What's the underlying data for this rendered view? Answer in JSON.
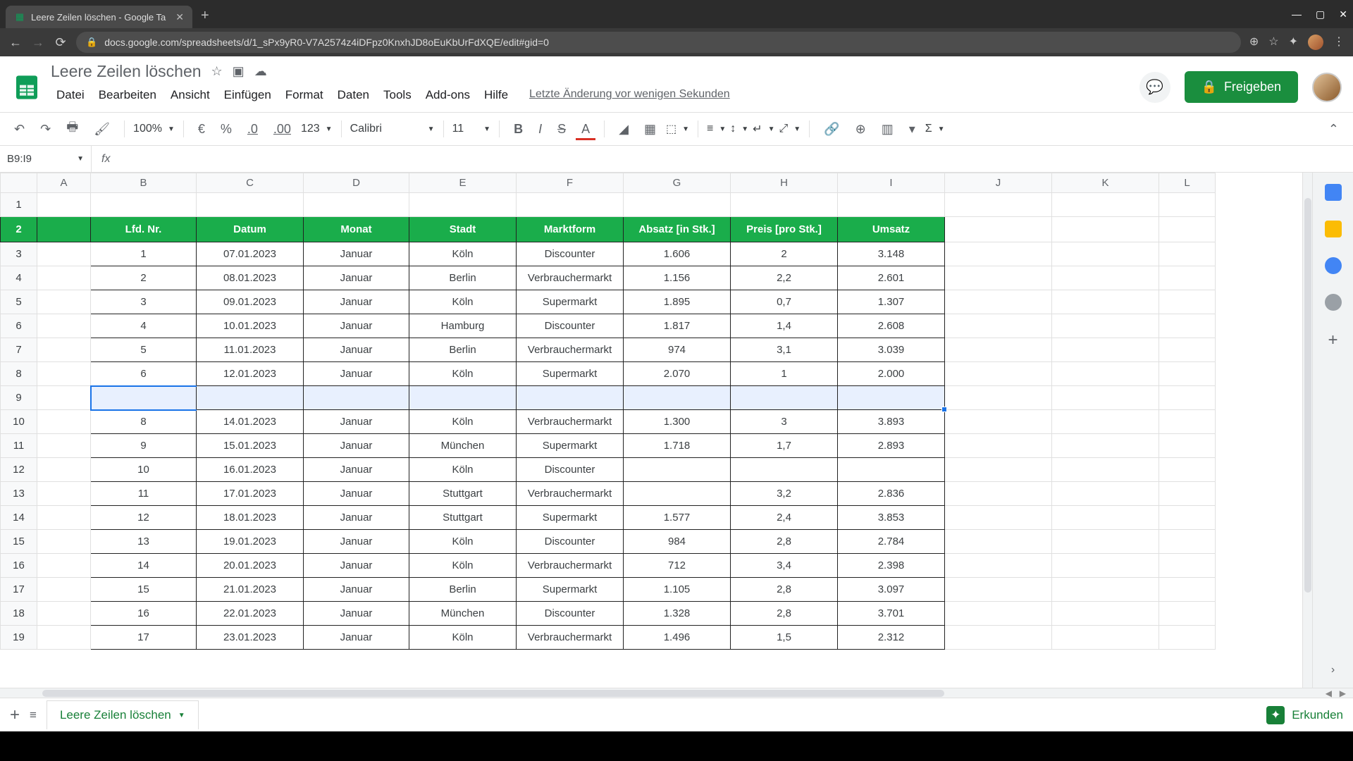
{
  "browser": {
    "tab_title": "Leere Zeilen löschen - Google Ta",
    "url": "docs.google.com/spreadsheets/d/1_sPx9yR0-V7A2574z4iDFpz0KnxhJD8oEuKbUrFdXQE/edit#gid=0"
  },
  "doc": {
    "title": "Leere Zeilen löschen",
    "menus": [
      "Datei",
      "Bearbeiten",
      "Ansicht",
      "Einfügen",
      "Format",
      "Daten",
      "Tools",
      "Add-ons",
      "Hilfe"
    ],
    "last_edit": "Letzte Änderung vor wenigen Sekunden",
    "share_label": "Freigeben"
  },
  "toolbar": {
    "zoom": "100%",
    "currency": "€",
    "percent": "%",
    "dec_less": ".0",
    "dec_more": ".00",
    "numfmt": "123",
    "font": "Calibri",
    "fontsize": "11"
  },
  "namebox": "B9:I9",
  "columns": [
    "A",
    "B",
    "C",
    "D",
    "E",
    "F",
    "G",
    "H",
    "I",
    "J",
    "K",
    "L"
  ],
  "colwidths": [
    "cA",
    "cB",
    "cC",
    "cD",
    "cE",
    "cF",
    "cG",
    "cH",
    "cI",
    "cJ",
    "cK",
    "cL"
  ],
  "row_numbers": [
    "1",
    "2",
    "3",
    "4",
    "5",
    "6",
    "7",
    "8",
    "9",
    "10",
    "11",
    "12",
    "13",
    "14",
    "15",
    "16",
    "17",
    "18",
    "19"
  ],
  "header_row": [
    "Lfd. Nr.",
    "Datum",
    "Monat",
    "Stadt",
    "Marktform",
    "Absatz [in Stk.]",
    "Preis [pro Stk.]",
    "Umsatz"
  ],
  "data_rows": [
    [
      "1",
      "07.01.2023",
      "Januar",
      "Köln",
      "Discounter",
      "1.606",
      "2",
      "3.148"
    ],
    [
      "2",
      "08.01.2023",
      "Januar",
      "Berlin",
      "Verbrauchermarkt",
      "1.156",
      "2,2",
      "2.601"
    ],
    [
      "3",
      "09.01.2023",
      "Januar",
      "Köln",
      "Supermarkt",
      "1.895",
      "0,7",
      "1.307"
    ],
    [
      "4",
      "10.01.2023",
      "Januar",
      "Hamburg",
      "Discounter",
      "1.817",
      "1,4",
      "2.608"
    ],
    [
      "5",
      "11.01.2023",
      "Januar",
      "Berlin",
      "Verbrauchermarkt",
      "974",
      "3,1",
      "3.039"
    ],
    [
      "6",
      "12.01.2023",
      "Januar",
      "Köln",
      "Supermarkt",
      "2.070",
      "1",
      "2.000"
    ],
    [
      "",
      "",
      "",
      "",
      "",
      "",
      "",
      ""
    ],
    [
      "8",
      "14.01.2023",
      "Januar",
      "Köln",
      "Verbrauchermarkt",
      "1.300",
      "3",
      "3.893"
    ],
    [
      "9",
      "15.01.2023",
      "Januar",
      "München",
      "Supermarkt",
      "1.718",
      "1,7",
      "2.893"
    ],
    [
      "10",
      "16.01.2023",
      "Januar",
      "Köln",
      "Discounter",
      "",
      "",
      ""
    ],
    [
      "11",
      "17.01.2023",
      "Januar",
      "Stuttgart",
      "Verbrauchermarkt",
      "",
      "3,2",
      "2.836"
    ],
    [
      "12",
      "18.01.2023",
      "Januar",
      "Stuttgart",
      "Supermarkt",
      "1.577",
      "2,4",
      "3.853"
    ],
    [
      "13",
      "19.01.2023",
      "Januar",
      "Köln",
      "Discounter",
      "984",
      "2,8",
      "2.784"
    ],
    [
      "14",
      "20.01.2023",
      "Januar",
      "Köln",
      "Verbrauchermarkt",
      "712",
      "3,4",
      "2.398"
    ],
    [
      "15",
      "21.01.2023",
      "Januar",
      "Berlin",
      "Supermarkt",
      "1.105",
      "2,8",
      "3.097"
    ],
    [
      "16",
      "22.01.2023",
      "Januar",
      "München",
      "Discounter",
      "1.328",
      "2,8",
      "3.701"
    ],
    [
      "17",
      "23.01.2023",
      "Januar",
      "Köln",
      "Verbrauchermarkt",
      "1.496",
      "1,5",
      "2.312"
    ]
  ],
  "selected_row_index": 6,
  "sheet_tab": "Leere Zeilen löschen",
  "explore": "Erkunden",
  "chart_data": {
    "type": "table",
    "columns": [
      "Lfd. Nr.",
      "Datum",
      "Monat",
      "Stadt",
      "Marktform",
      "Absatz [in Stk.]",
      "Preis [pro Stk.]",
      "Umsatz"
    ],
    "rows": [
      [
        1,
        "07.01.2023",
        "Januar",
        "Köln",
        "Discounter",
        1606,
        2,
        3148
      ],
      [
        2,
        "08.01.2023",
        "Januar",
        "Berlin",
        "Verbrauchermarkt",
        1156,
        2.2,
        2601
      ],
      [
        3,
        "09.01.2023",
        "Januar",
        "Köln",
        "Supermarkt",
        1895,
        0.7,
        1307
      ],
      [
        4,
        "10.01.2023",
        "Januar",
        "Hamburg",
        "Discounter",
        1817,
        1.4,
        2608
      ],
      [
        5,
        "11.01.2023",
        "Januar",
        "Berlin",
        "Verbrauchermarkt",
        974,
        3.1,
        3039
      ],
      [
        6,
        "12.01.2023",
        "Januar",
        "Köln",
        "Supermarkt",
        2070,
        1,
        2000
      ],
      [
        null,
        null,
        null,
        null,
        null,
        null,
        null,
        null
      ],
      [
        8,
        "14.01.2023",
        "Januar",
        "Köln",
        "Verbrauchermarkt",
        1300,
        3,
        3893
      ],
      [
        9,
        "15.01.2023",
        "Januar",
        "München",
        "Supermarkt",
        1718,
        1.7,
        2893
      ],
      [
        10,
        "16.01.2023",
        "Januar",
        "Köln",
        "Discounter",
        null,
        null,
        null
      ],
      [
        11,
        "17.01.2023",
        "Januar",
        "Stuttgart",
        "Verbrauchermarkt",
        null,
        3.2,
        2836
      ],
      [
        12,
        "18.01.2023",
        "Januar",
        "Stuttgart",
        "Supermarkt",
        1577,
        2.4,
        3853
      ],
      [
        13,
        "19.01.2023",
        "Januar",
        "Köln",
        "Discounter",
        984,
        2.8,
        2784
      ],
      [
        14,
        "20.01.2023",
        "Januar",
        "Köln",
        "Verbrauchermarkt",
        712,
        3.4,
        2398
      ],
      [
        15,
        "21.01.2023",
        "Januar",
        "Berlin",
        "Supermarkt",
        1105,
        2.8,
        3097
      ],
      [
        16,
        "22.01.2023",
        "Januar",
        "München",
        "Discounter",
        1328,
        2.8,
        3701
      ],
      [
        17,
        "23.01.2023",
        "Januar",
        "Köln",
        "Verbrauchermarkt",
        1496,
        1.5,
        2312
      ]
    ]
  }
}
